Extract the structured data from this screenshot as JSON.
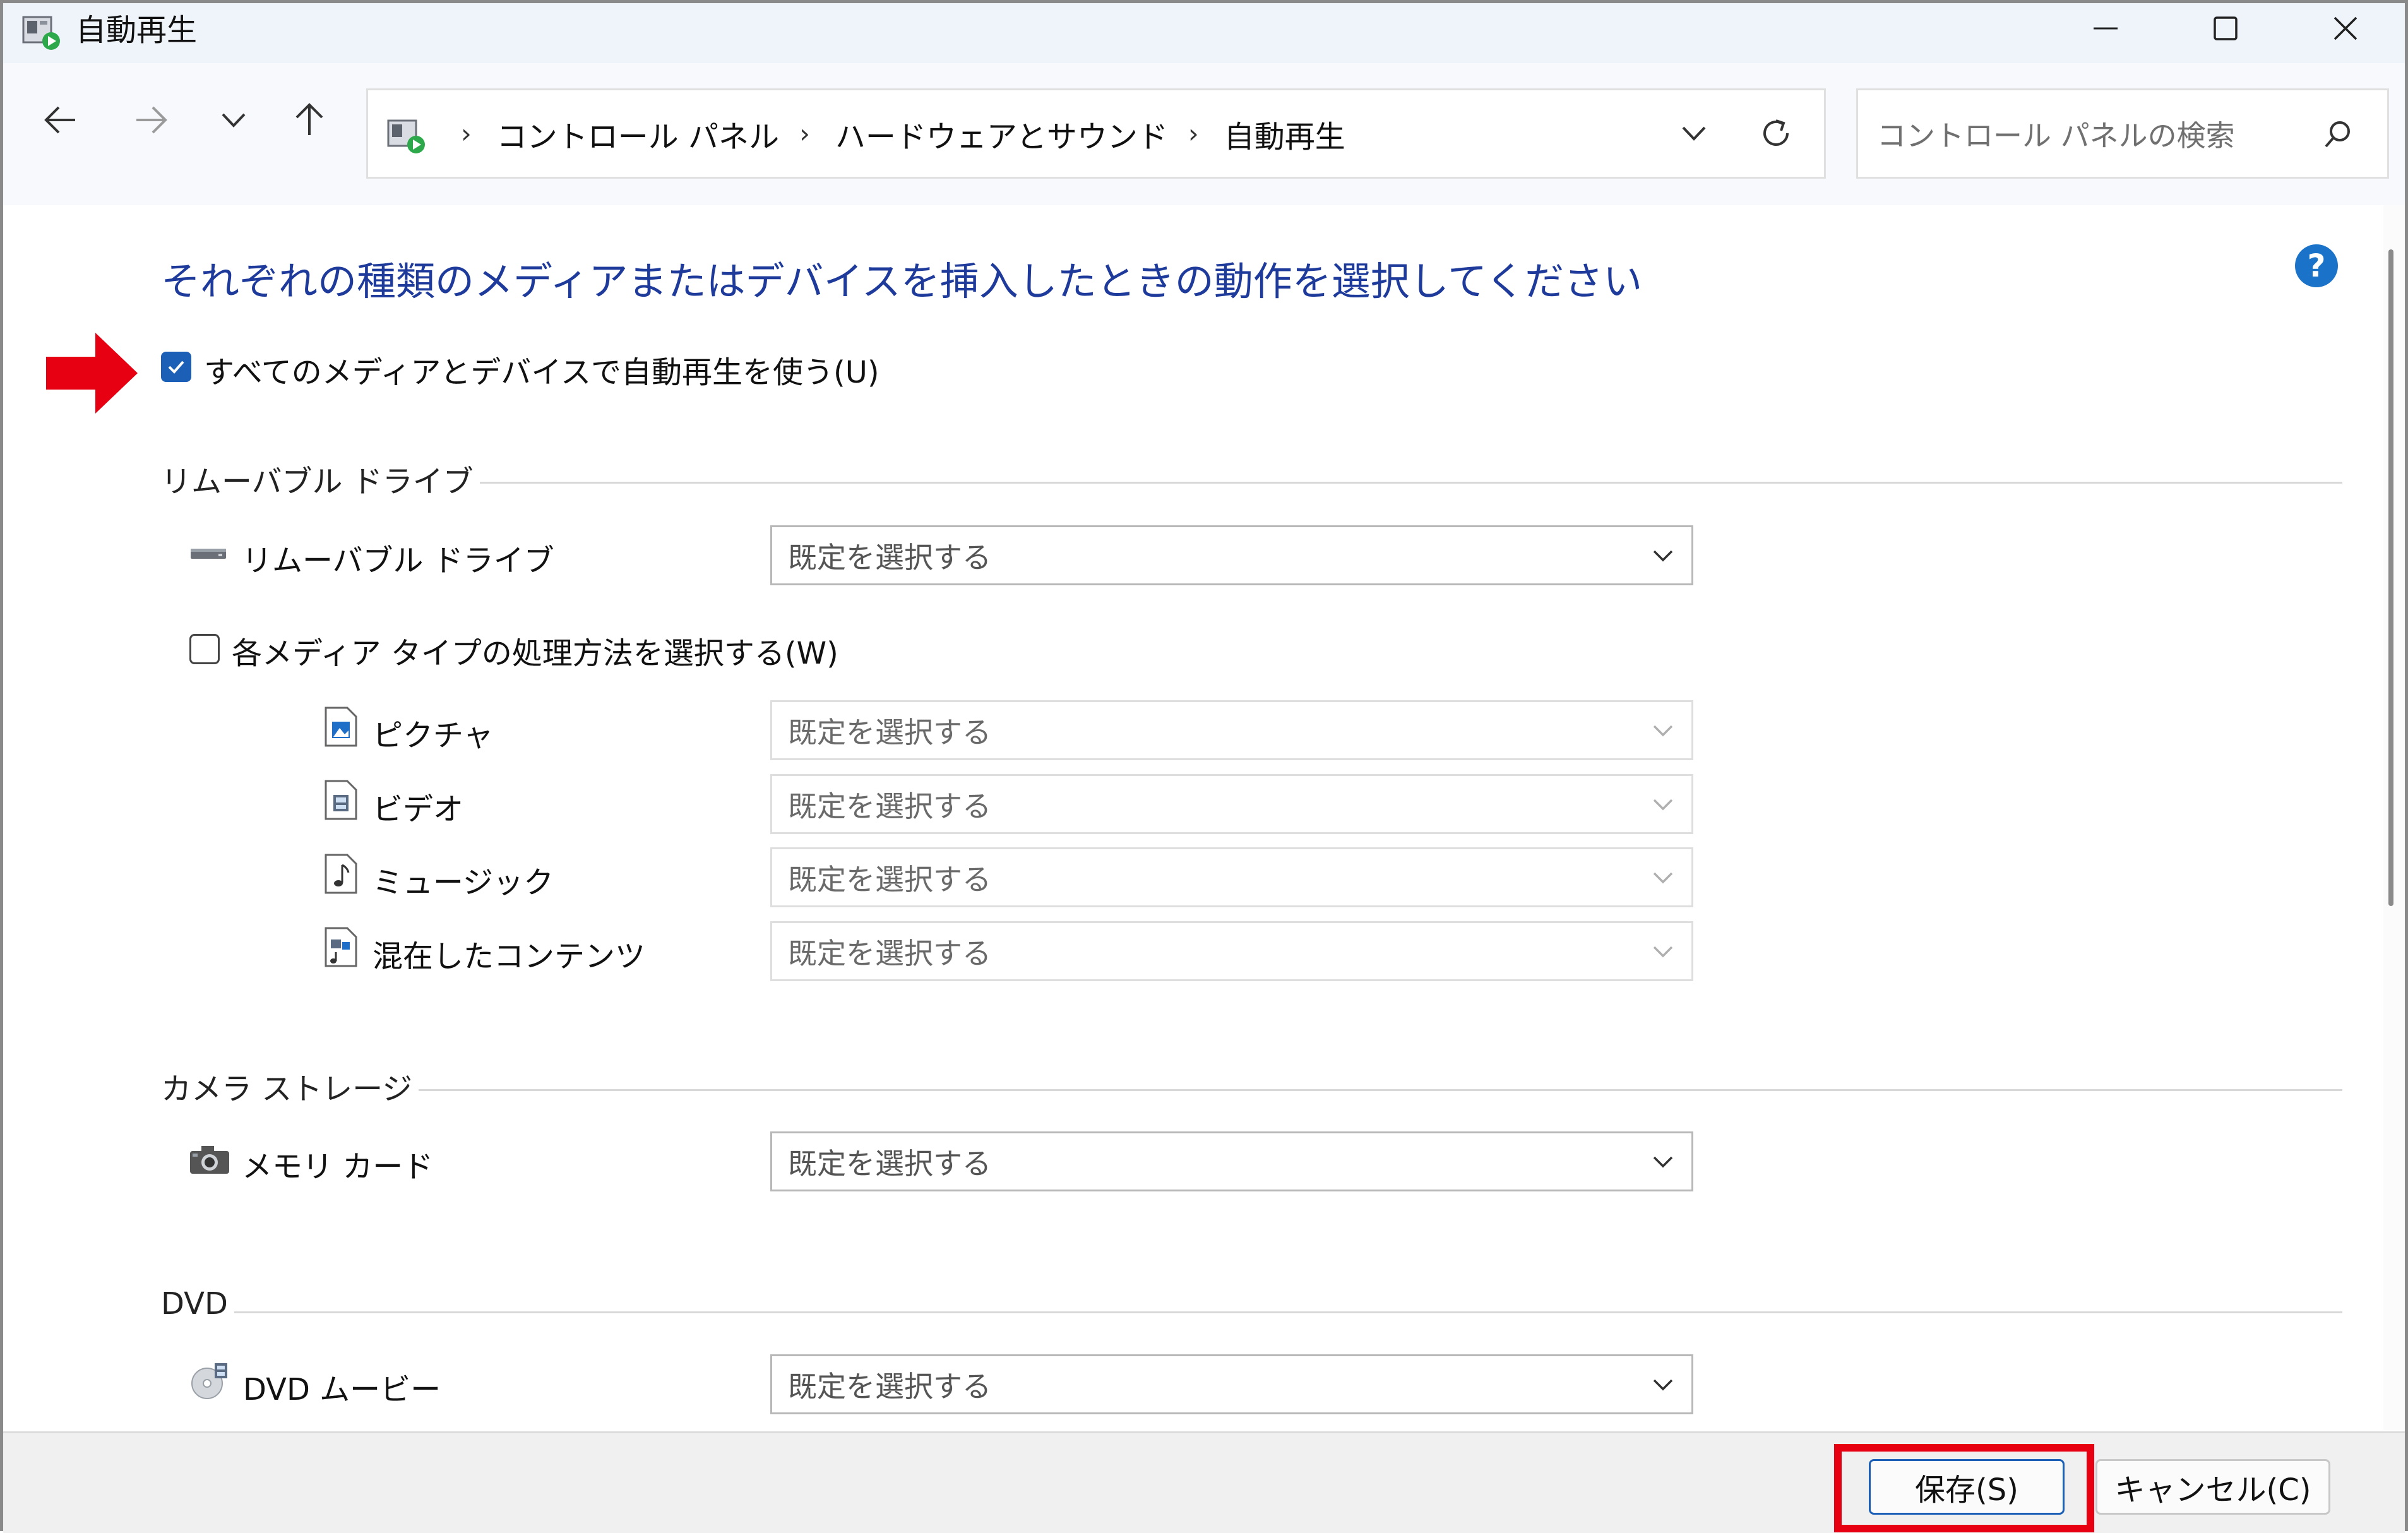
{
  "window": {
    "title": "自動再生"
  },
  "address": {
    "crumbs": [
      "コントロール パネル",
      "ハードウェアとサウンド",
      "自動再生"
    ]
  },
  "search": {
    "placeholder": "コントロール パネルの検索"
  },
  "main": {
    "heading": "それぞれの種類のメディアまたはデバイスを挿入したときの動作を選択してください",
    "use_autoplay": {
      "label": "すべてのメディアとデバイスで自動再生を使う(U)",
      "checked": true
    },
    "sections": {
      "removable": {
        "title": "リムーバブル ドライブ",
        "drive_label": "リムーバブル ドライブ",
        "drive_value": "既定を選択する",
        "per_media": {
          "label": "各メディア タイプの処理方法を選択する(W)",
          "checked": false
        },
        "media": [
          {
            "label": "ピクチャ",
            "value": "既定を選択する",
            "icon": "picture-file-icon"
          },
          {
            "label": "ビデオ",
            "value": "既定を選択する",
            "icon": "video-file-icon"
          },
          {
            "label": "ミュージック",
            "value": "既定を選択する",
            "icon": "music-file-icon"
          },
          {
            "label": "混在したコンテンツ",
            "value": "既定を選択する",
            "icon": "mixed-file-icon"
          }
        ]
      },
      "camera": {
        "title": "カメラ ストレージ",
        "memory_label": "メモリ カード",
        "memory_value": "既定を選択する"
      },
      "dvd": {
        "title": "DVD",
        "movie_label": "DVD ムービー",
        "movie_value": "既定を選択する"
      }
    }
  },
  "footer": {
    "save_label": "保存(S)",
    "cancel_label": "キャンセル(C)"
  },
  "colors": {
    "heading": "#1e3a9a",
    "accent": "#1b5fb6",
    "highlight": "#e60012",
    "arrow": "#e60012"
  }
}
